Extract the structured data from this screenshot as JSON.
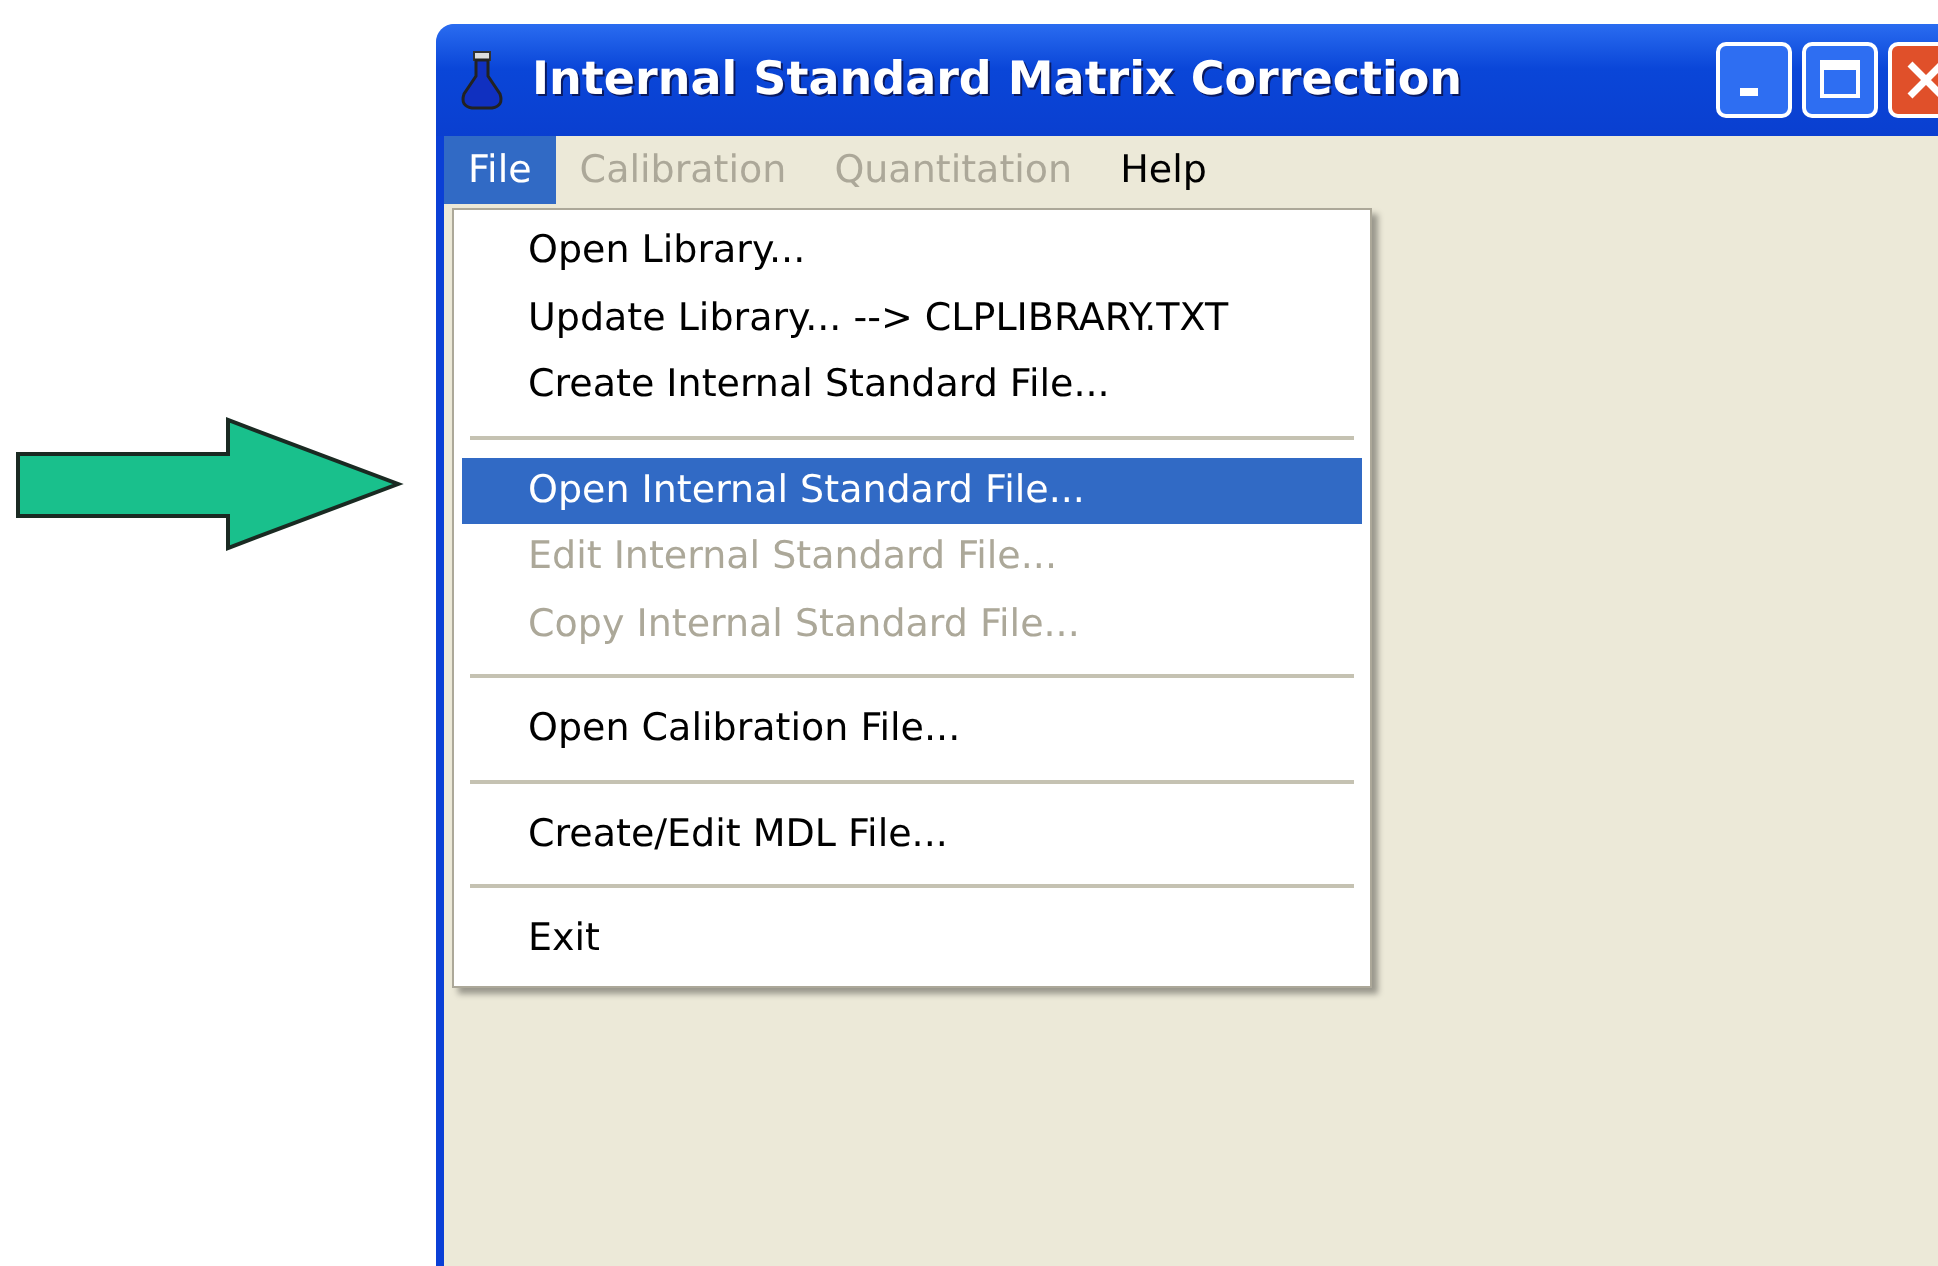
{
  "window": {
    "title": "Internal Standard Matrix Correction"
  },
  "menu_bar": [
    {
      "label": "File",
      "selected": true,
      "disabled": false
    },
    {
      "label": "Calibration",
      "selected": false,
      "disabled": true
    },
    {
      "label": "Quantitation",
      "selected": false,
      "disabled": true
    },
    {
      "label": "Help",
      "selected": false,
      "disabled": false
    }
  ],
  "file_menu": [
    {
      "kind": "item",
      "label": "Open Library...",
      "selected": false,
      "disabled": false
    },
    {
      "kind": "item",
      "label": "Update Library... --> CLPLIBRARY.TXT",
      "selected": false,
      "disabled": false
    },
    {
      "kind": "item",
      "label": "Create Internal Standard File...",
      "selected": false,
      "disabled": false
    },
    {
      "kind": "separator"
    },
    {
      "kind": "item",
      "label": "Open Internal Standard File...",
      "selected": true,
      "disabled": false
    },
    {
      "kind": "item",
      "label": "Edit Internal Standard File...",
      "selected": false,
      "disabled": true
    },
    {
      "kind": "item",
      "label": "Copy Internal Standard File...",
      "selected": false,
      "disabled": true
    },
    {
      "kind": "separator"
    },
    {
      "kind": "item",
      "label": "Open Calibration File...",
      "selected": false,
      "disabled": false
    },
    {
      "kind": "separator"
    },
    {
      "kind": "item",
      "label": "Create/Edit MDL File...",
      "selected": false,
      "disabled": false
    },
    {
      "kind": "separator"
    },
    {
      "kind": "item",
      "label": "Exit",
      "selected": false,
      "disabled": false
    }
  ]
}
